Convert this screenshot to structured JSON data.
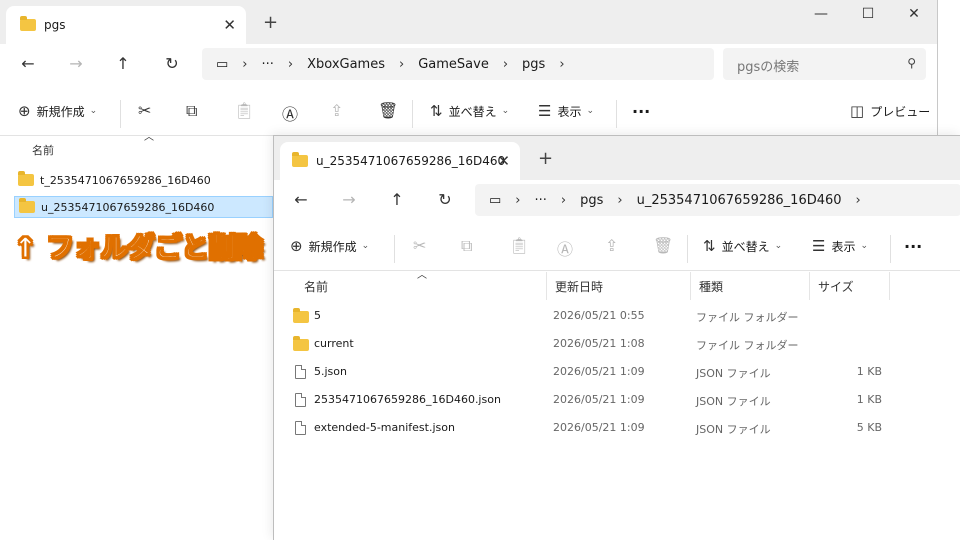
{
  "back_window": {
    "tab_title": "pgs",
    "breadcrumbs": [
      "XboxGames",
      "GameSave",
      "pgs"
    ],
    "search_placeholder": "pgsの検索",
    "toolbar": {
      "new_label": "新規作成",
      "sort_label": "並べ替え",
      "view_label": "表示",
      "more_label": "...",
      "preview_label": "プレビュー"
    },
    "list_header": "名前",
    "items": [
      {
        "name": "t_2535471067659286_16D460"
      },
      {
        "name": "u_2535471067659286_16D460",
        "selected": true
      }
    ]
  },
  "front_window": {
    "tab_title": "u_2535471067659286_16D460",
    "breadcrumbs": [
      "pgs",
      "u_2535471067659286_16D460"
    ],
    "toolbar": {
      "new_label": "新規作成",
      "sort_label": "並べ替え",
      "view_label": "表示",
      "more_label": "..."
    },
    "columns": {
      "name": "名前",
      "date": "更新日時",
      "type": "種類",
      "size": "サイズ"
    },
    "rows": [
      {
        "icon": "folder",
        "name": "5",
        "date": "2026/05/21 0:55",
        "type": "ファイル フォルダー",
        "size": ""
      },
      {
        "icon": "folder-shortcut",
        "name": "current",
        "date": "2026/05/21 1:08",
        "type": "ファイル フォルダー",
        "size": ""
      },
      {
        "icon": "file",
        "name": "5.json",
        "date": "2026/05/21 1:09",
        "type": "JSON ファイル",
        "size": "1 KB"
      },
      {
        "icon": "file",
        "name": "2535471067659286_16D460.json",
        "date": "2026/05/21 1:09",
        "type": "JSON ファイル",
        "size": "1 KB"
      },
      {
        "icon": "file",
        "name": "extended-5-manifest.json",
        "date": "2026/05/21 1:09",
        "type": "JSON ファイル",
        "size": "5 KB"
      }
    ]
  },
  "annotation": {
    "arrow": "↑",
    "text": "フォルダごと削除"
  },
  "colors": {
    "selection": "#cce8ff",
    "annotation_outline": "#e07000",
    "folder": "#f4c542"
  }
}
